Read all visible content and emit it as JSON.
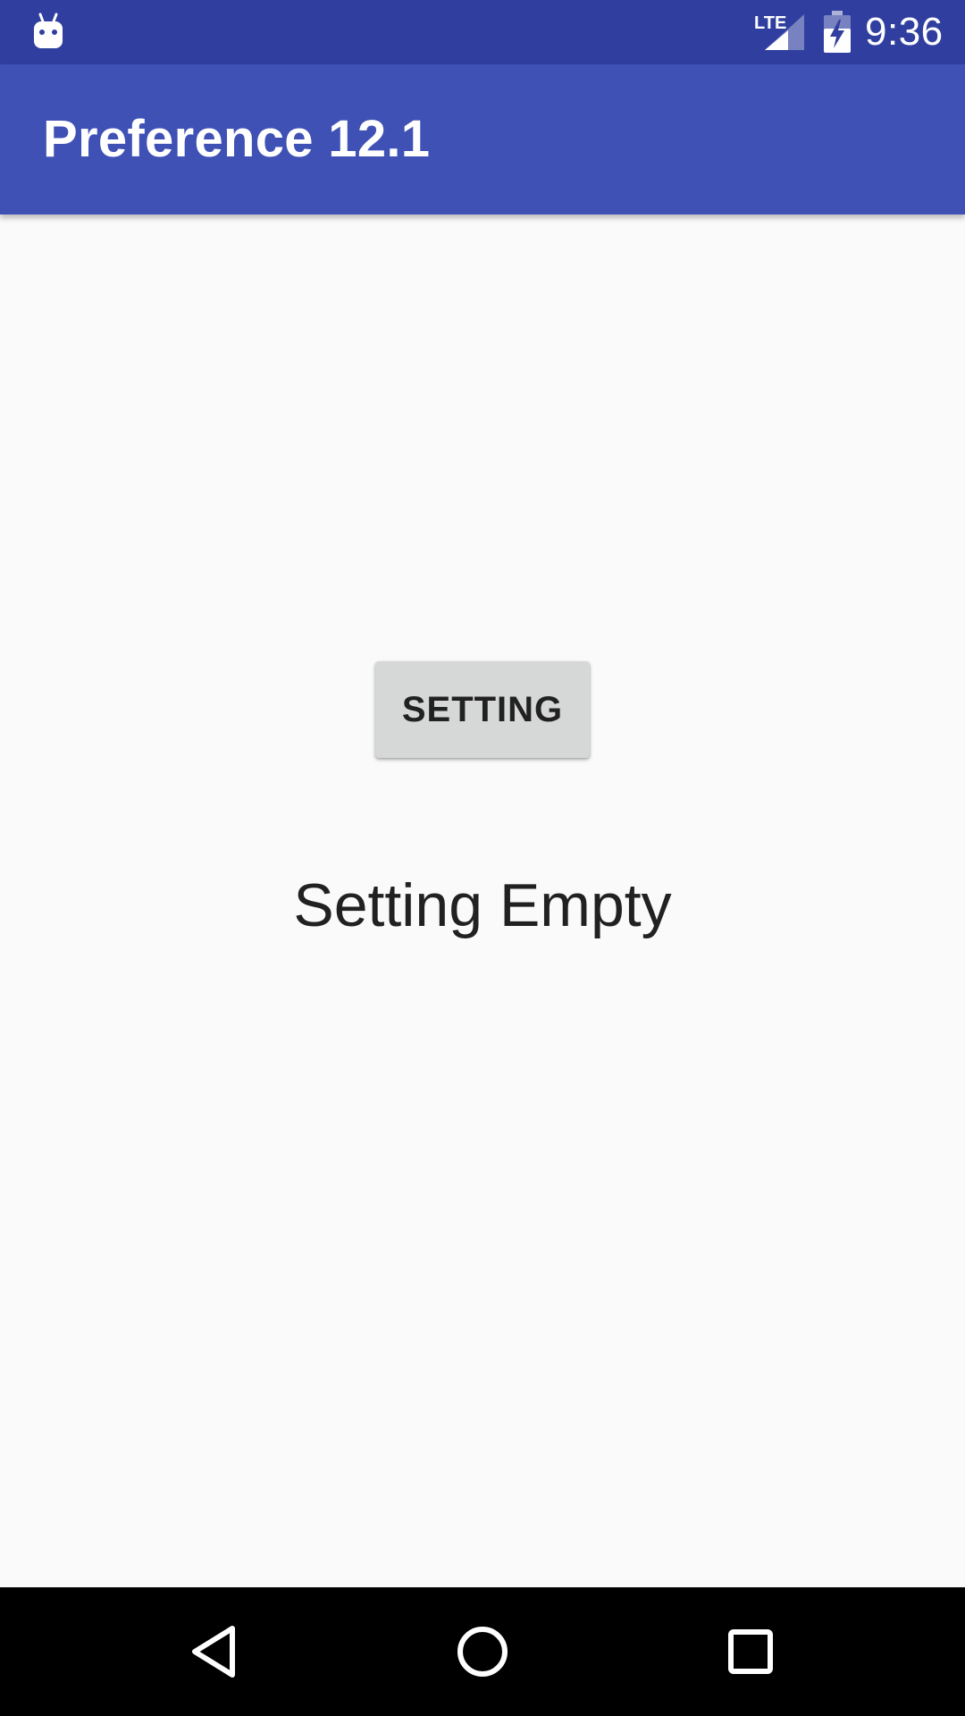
{
  "status_bar": {
    "time": "9:36",
    "network_label": "LTE",
    "icons": [
      "android-notification-icon",
      "lte-signal-icon",
      "battery-charging-icon"
    ]
  },
  "app_bar": {
    "title": "Preference 12.1"
  },
  "main": {
    "button_label": "SETTING",
    "status_text": "Setting Empty"
  },
  "nav_bar": {
    "icons": [
      "back-icon",
      "home-icon",
      "recents-icon"
    ]
  },
  "colors": {
    "status_bar": "#303f9f",
    "primary": "#3f51b5",
    "background": "#fafafa",
    "button": "#d6d7d7",
    "text": "#212121",
    "nav_bar": "#000000"
  }
}
